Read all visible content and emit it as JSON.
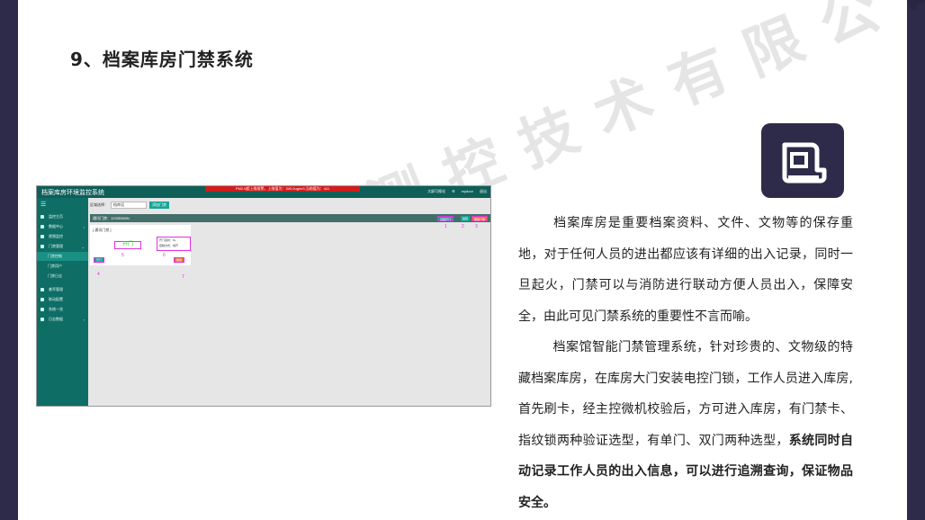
{
  "slide": {
    "title": "9、档案库房门禁系统",
    "watermark": "山东仁科测控技术有限公司",
    "paragraph1": "档案库房是重要档案资料、文件、文物等的保存重地，对于任何人员的进出都应该有详细的出入记录，同时一旦起火，门禁可以与消防进行联动方便人员出入，保障安全，由此可见门禁系统的重要性不言而喻。",
    "paragraph2_normal": "档案馆智能门禁管理系统，针对珍贵的、文物级的特藏档案库房，在库房大门安装电控门锁，工作人员进入库房,首先刷卡，经主控微机校验后，方可进入库房，有门禁卡、指纹锁两种验证选型，有单门、双门两种选型，",
    "paragraph2_bold": "系统同时自动记录工作人员的出入信息，可以进行追溯查询，保证物品安全。"
  },
  "colors": {
    "dark_navy": "#2e2b4a",
    "teal": "#0e6e66",
    "alarm_red": "#d31c1c",
    "annotation_pink": "#e62ee0"
  },
  "app": {
    "title": "档案库房环境监控系统",
    "alarm": "PM2.5超上限报警，上限值为：300,0ug/m3,当前值为：411",
    "top_right": [
      "大屏可视化",
      "⚙",
      "mydoor",
      "退出"
    ],
    "menu_toggle": "☰",
    "menu": [
      {
        "label": "监控主页",
        "icon": "home-icon"
      },
      {
        "label": "数据中心",
        "icon": "database-icon",
        "caret": "›"
      },
      {
        "label": "视频监控",
        "icon": "video-icon"
      },
      {
        "label": "门禁管理",
        "icon": "door-icon",
        "caret": "⌄"
      },
      {
        "label": "门禁控制",
        "icon": "",
        "active": true
      },
      {
        "label": "门禁用户",
        "icon": ""
      },
      {
        "label": "门禁日志",
        "icon": ""
      },
      {
        "label": "着军管理",
        "icon": "user-icon"
      },
      {
        "label": "联动配置",
        "icon": "share-icon"
      },
      {
        "label": "系统一览",
        "icon": "grid-icon"
      },
      {
        "label": "日志数据",
        "icon": "list-icon",
        "caret": "›"
      }
    ],
    "filter": {
      "label": "区域选择：",
      "value": "档库设",
      "button": "添加门禁"
    },
    "door_bar": {
      "label": "通讯门禁：12335380N",
      "btn1": "远程开门",
      "btn2": "编辑",
      "btn3": "删除门禁"
    },
    "card": {
      "title": "[ 通讯门禁 ]",
      "open_text": "开门",
      "status_line1": "开门延时：5s",
      "status_line2": "控制方式：常开",
      "open_btn": "开门",
      "delete_btn": "删除"
    },
    "annotations": [
      "1",
      "2",
      "3",
      "4",
      "5",
      "6",
      "7"
    ]
  }
}
